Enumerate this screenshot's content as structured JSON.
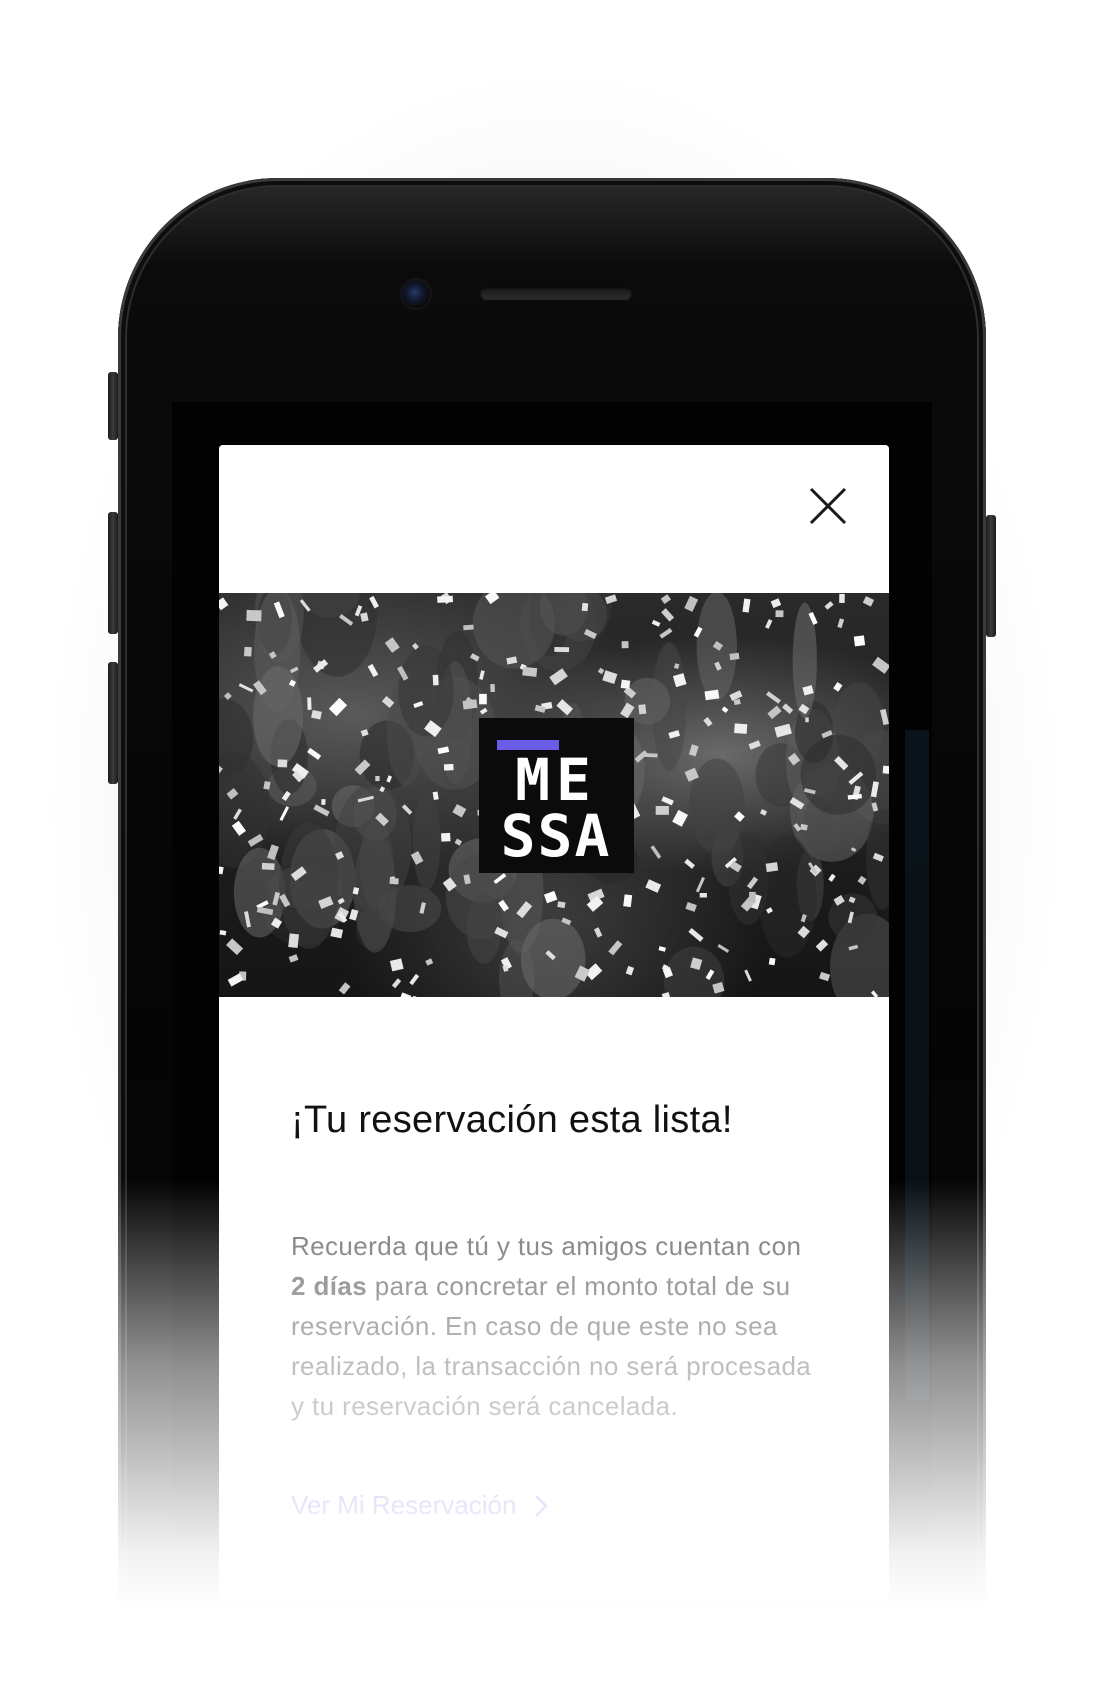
{
  "brand": {
    "logo_line1": "ME",
    "logo_line2": "SSA",
    "accent_color": "#6B5CE7"
  },
  "modal": {
    "close_icon": "close-icon",
    "title": "¡Tu reservación esta lista!",
    "message_before": "Recuerda que tú y tus amigos cuentan con ",
    "message_bold": "2 días",
    "message_after": " para concretar el monto total de su reservación. En caso de que este no sea realizado, la transacción no será procesada y tu reservación será cancelada.",
    "link_label": "Ver Mi Reservación",
    "link_icon": "chevron-right-icon"
  }
}
